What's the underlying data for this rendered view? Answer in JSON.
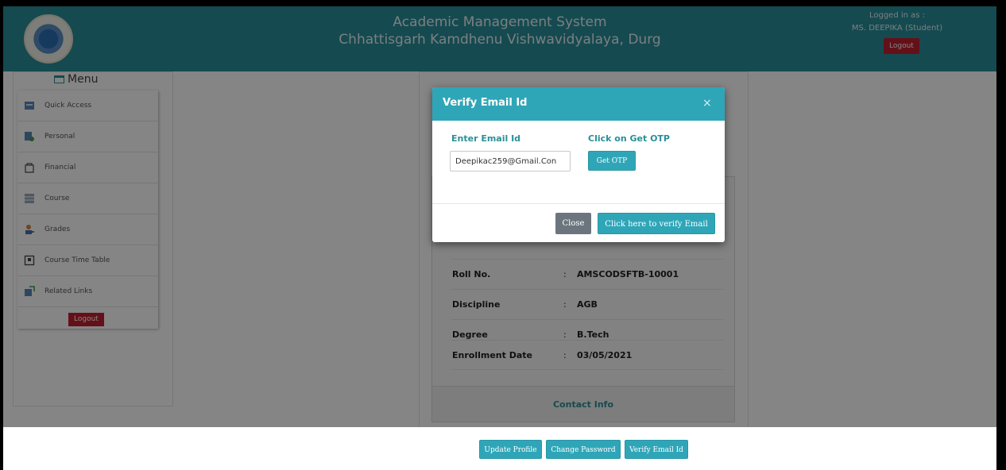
{
  "header": {
    "title": "Academic Management System",
    "subtitle": "Chhattisgarh Kamdhenu Vishwavidyalaya, Durg",
    "logged_label": "Logged in as :",
    "logged_user": "MS. DEEPIKA (Student)",
    "logout_label": "Logout"
  },
  "sidebar": {
    "title": "Menu",
    "items": [
      {
        "label": "Quick Access",
        "icon": "quick-access-icon"
      },
      {
        "label": "Personal",
        "icon": "personal-icon"
      },
      {
        "label": "Financial",
        "icon": "financial-icon"
      },
      {
        "label": "Course",
        "icon": "course-icon"
      },
      {
        "label": "Grades",
        "icon": "grades-icon"
      },
      {
        "label": "Course Time Table",
        "icon": "timetable-icon"
      },
      {
        "label": "Related Links",
        "icon": "related-links-icon"
      }
    ],
    "logout_label": "Logout"
  },
  "profile": {
    "rows": [
      {
        "key": "Roll No.",
        "sep": ":",
        "value": "AMSCODSFTB-10001"
      },
      {
        "key": "Discipline",
        "sep": ":",
        "value": "AGB"
      },
      {
        "key": "Degree",
        "sep": ":",
        "value": "B.Tech"
      },
      {
        "key": "Enrollment Date",
        "sep": ":",
        "value": "03/05/2021"
      }
    ],
    "contact_label": "Contact Info"
  },
  "footer": {
    "update_profile": "Update Profile",
    "change_password": "Change Password",
    "verify_email": "Verify Email Id"
  },
  "modal": {
    "title": "Verify Email Id",
    "close_symbol": "×",
    "email_label": "Enter Email Id",
    "email_value": "Deepikac259@Gmail.Con",
    "otp_label": "Click on Get OTP",
    "otp_button": "Get OTP",
    "close_button": "Close",
    "verify_button": "Click here to verify Email"
  },
  "colors": {
    "brand": "#2a8f99",
    "accent": "#2fa6b8",
    "danger": "#c0202e"
  }
}
